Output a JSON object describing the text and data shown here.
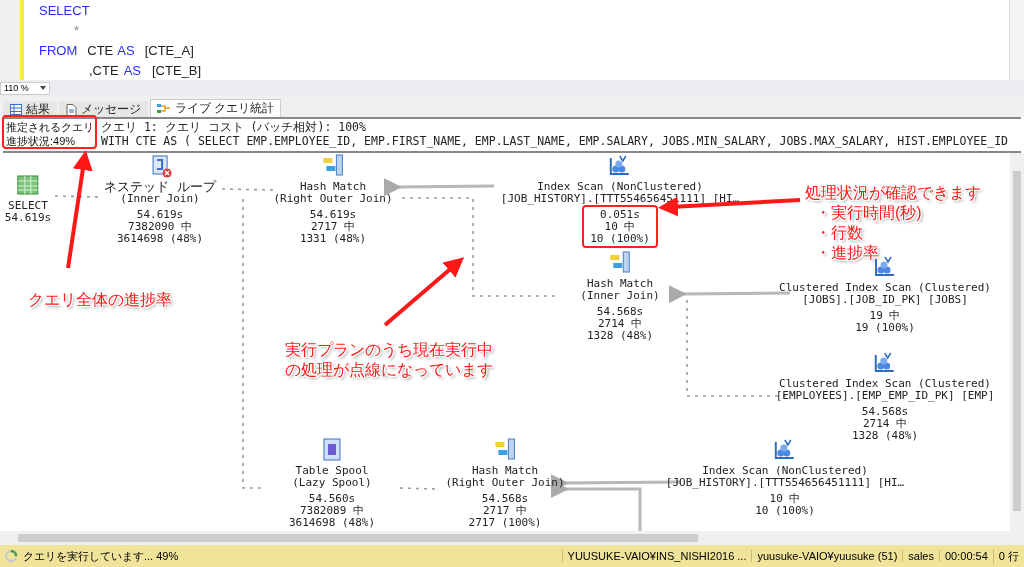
{
  "editor": {
    "lines": [
      {
        "tokens": [
          {
            "text": "SELECT",
            "kind": "keyword"
          }
        ]
      },
      {
        "tokens": [
          {
            "text": "*",
            "kind": "symbol"
          }
        ]
      },
      {
        "tokens": [
          {
            "text": "FROM",
            "kind": "keyword"
          },
          {
            "text": "CTE",
            "kind": "plain"
          },
          {
            "text": "AS",
            "kind": "keyword"
          },
          {
            "text": "[CTE_A]",
            "kind": "plain"
          }
        ]
      },
      {
        "tokens": [
          {
            "text": ",CTE",
            "kind": "plain"
          },
          {
            "text": "AS",
            "kind": "keyword"
          },
          {
            "text": "[CTE_B]",
            "kind": "plain"
          }
        ]
      }
    ]
  },
  "zoom": {
    "value": "110 %"
  },
  "tabs": [
    {
      "label": "結果",
      "selected": false
    },
    {
      "label": "メッセージ",
      "selected": false
    },
    {
      "label": "ライブ クエリ統計",
      "selected": true
    }
  ],
  "query_header": {
    "label": "推定されるクエリ",
    "progress": "進捗状況:49%",
    "cost": "クエリ 1: クエリ コスト (バッチ相対): 100%",
    "sql": "WITH CTE AS ( SELECT EMP.EMPLOYEE_ID, EMP.FIRST_NAME, EMP.LAST_NAME, EMP.SALARY, JOBS.MIN_SALARY, JOBS.MAX_SALARY, HIST.EMPLOYEE_ID"
  },
  "plan_nodes": [
    {
      "kind": "select",
      "warning": false,
      "lines": [
        "SELECT",
        "54.619s"
      ]
    },
    {
      "kind": "nested_loop",
      "warning": true,
      "lines": [
        "ネステッド ループ",
        "(Inner Join)",
        "54.619s",
        "7382090 中",
        "3614698 (48%)"
      ]
    },
    {
      "kind": "hash_match",
      "warning": false,
      "lines": [
        "Hash Match",
        "(Right Outer Join)",
        "54.619s",
        "2717 中",
        "1331 (48%)"
      ]
    },
    {
      "kind": "index_scan",
      "warning": false,
      "lines": [
        "Index Scan (NonClustered)",
        "[JOB_HISTORY].[TTT554656451111] [HI…",
        "0.051s",
        "10 中",
        "10 (100%)"
      ]
    },
    {
      "kind": "hash_match",
      "warning": false,
      "lines": [
        "Hash Match",
        "(Inner Join)",
        "54.568s",
        "2714 中",
        "1328 (48%)"
      ]
    },
    {
      "kind": "clustered_scan",
      "warning": false,
      "lines": [
        "Clustered Index Scan (Clustered)",
        "[JOBS].[JOB_ID_PK] [JOBS]",
        "19 中",
        "19 (100%)"
      ]
    },
    {
      "kind": "clustered_scan",
      "warning": false,
      "lines": [
        "Clustered Index Scan (Clustered)",
        "[EMPLOYEES].[EMP_EMP_ID_PK] [EMP]",
        "54.568s",
        "2714 中",
        "1328 (48%)"
      ]
    },
    {
      "kind": "spool",
      "warning": false,
      "lines": [
        "Table Spool",
        "(Lazy Spool)",
        "54.560s",
        "7382089 中",
        "3614698 (48%)"
      ]
    },
    {
      "kind": "hash_match",
      "warning": false,
      "lines": [
        "Hash Match",
        "(Right Outer Join)",
        "54.568s",
        "2717 中",
        "2717 (100%)"
      ]
    },
    {
      "kind": "index_scan",
      "warning": false,
      "lines": [
        "Index Scan (NonClustered)",
        "[JOB_HISTORY].[TTT554656451111] [HI…",
        "10 中",
        "10 (100%)"
      ]
    }
  ],
  "connectors": [
    {
      "active": true
    },
    {
      "active": true
    },
    {
      "active": true
    },
    {
      "active": false
    },
    {
      "active": true
    },
    {
      "active": false
    },
    {
      "active": true
    },
    {
      "active": true
    },
    {
      "active": false
    },
    {
      "active": false
    }
  ],
  "callouts": [
    {
      "lines": [
        "クエリ全体の進捗率"
      ]
    },
    {
      "lines": [
        "実行プランのうち現在実行中",
        "の処理が点線になっています"
      ]
    },
    {
      "lines": [
        "処理状況が確認できます",
        "・実行時間(秒)",
        "・行数",
        "・進捗率"
      ]
    }
  ],
  "status_bar": {
    "message": "クエリを実行しています... 49%",
    "cells": [
      "YUUSUKE-VAIO¥INS_NISHI2016 ...",
      "yuusuke-VAIO¥yuusuke (51)",
      "sales",
      "00:00:54",
      "0 行"
    ]
  }
}
